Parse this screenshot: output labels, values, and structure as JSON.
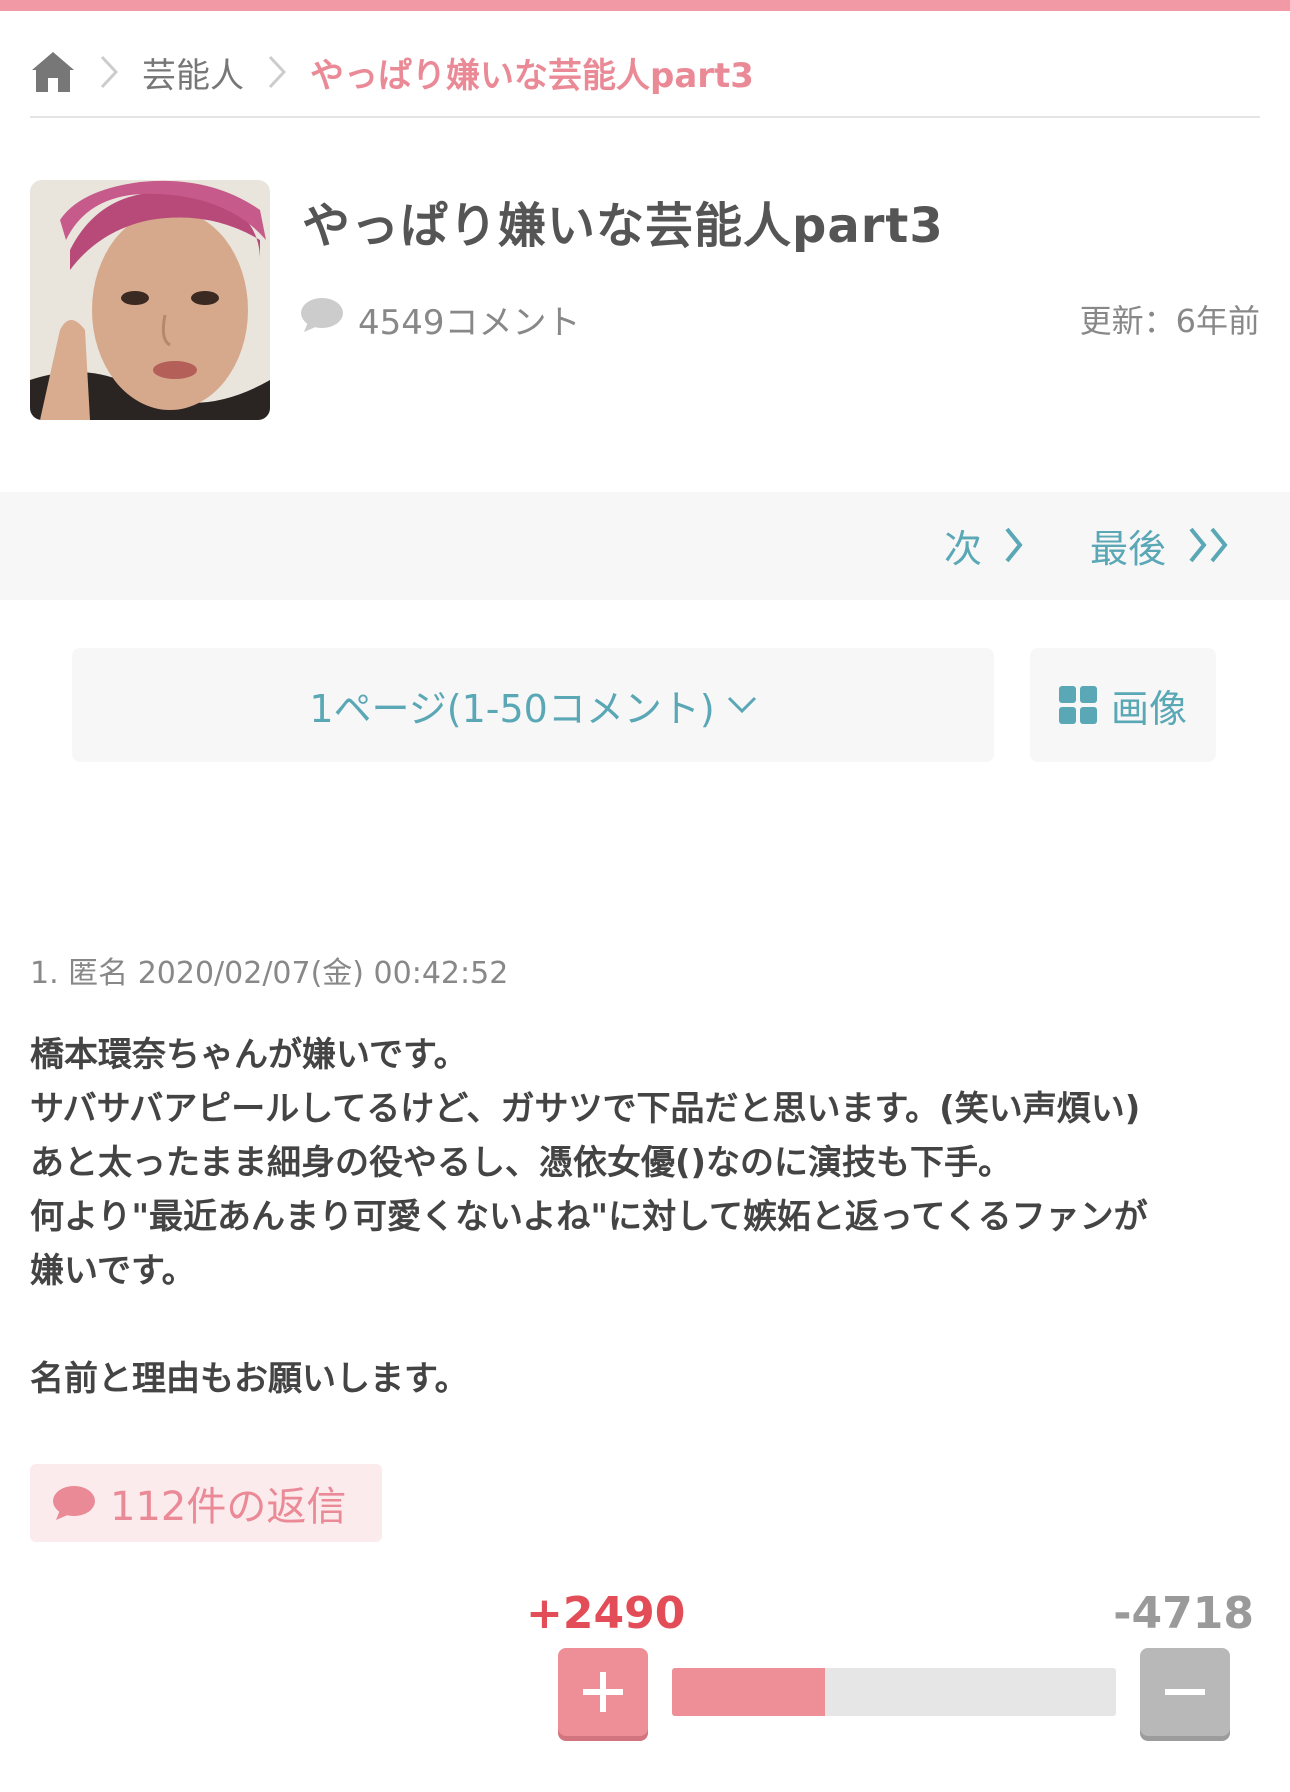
{
  "breadcrumb": {
    "category": "芸能人",
    "current": "やっぱり嫌いな芸能人part3"
  },
  "topic": {
    "title": "やっぱり嫌いな芸能人part3",
    "comment_count": "4549コメント",
    "updated": "更新：6年前"
  },
  "pager": {
    "next": "次",
    "last": "最後",
    "page_select": "1ページ(1-50コメント)",
    "images": "画像"
  },
  "comment": {
    "meta": "1. 匿名 2020/02/07(金) 00:42:52",
    "lines": [
      "橋本環奈ちゃんが嫌いです。",
      "サバサバアピールしてるけど、ガサツで下品だと思います。(笑い声煩い)",
      "あと太ったまま細身の役やるし、憑依女優()なのに演技も下手。",
      "何より\"最近あんまり可愛くないよね\"に対して嫉妬と返ってくるファンが",
      "嫌いです。",
      "",
      "名前と理由もお願いします。"
    ],
    "replies": "112件の返信",
    "plus": "+2490",
    "minus": "-4718",
    "plus_ratio": 0.345
  },
  "colors": {
    "accent_pink": "#ea8a96",
    "link_teal": "#5aa7b6",
    "plus_red": "#e24d57"
  }
}
